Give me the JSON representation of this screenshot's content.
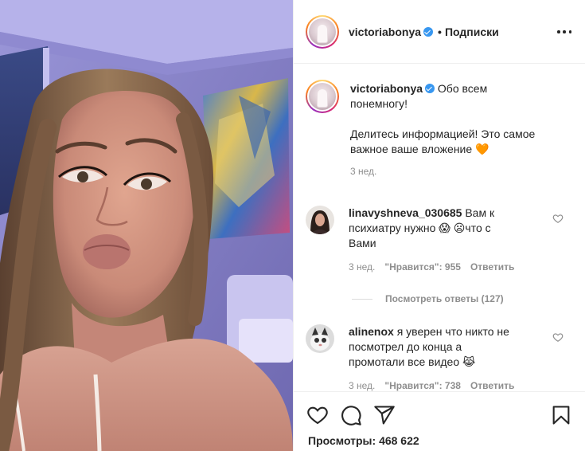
{
  "header": {
    "username": "victoriabonya",
    "separator": "•",
    "follow_label": "Подписки"
  },
  "caption": {
    "username": "victoriabonya",
    "line1": "Обо всем",
    "line2": "понемногу!",
    "line3": "Делитесь информацией! Это самое",
    "line4": "важное ваше вложение",
    "emoji": "🧡",
    "time": "3 нед."
  },
  "comments": [
    {
      "username": "linavyshneva_030685",
      "line1": "Вам к",
      "line2": "психиатру нужно",
      "emoji1": "😱",
      "emoji2": "😦",
      "line2b": "что с",
      "line3": "Вами",
      "time": "3 нед.",
      "likes_label": "\"Нравится\": 955",
      "reply_label": "Ответить",
      "view_replies": "Посмотреть ответы (127)"
    },
    {
      "username": "alinenox",
      "line1": "я уверен что никто не",
      "line2": "посмотрел до конца а",
      "line3": "промотали все видео",
      "emoji": "😹",
      "time": "3 нед.",
      "likes_label": "\"Нравится\": 738",
      "reply_label": "Ответить"
    }
  ],
  "footer": {
    "views_label": "Просмотры:",
    "views_count": "468 622"
  },
  "icons": {
    "like": "heart-icon",
    "comment": "comment-icon",
    "share": "share-icon",
    "save": "bookmark-icon",
    "more": "more-icon",
    "verified": "verified-badge-icon"
  },
  "colors": {
    "text": "#262626",
    "muted": "#8e8e8e",
    "verified": "#3897f0",
    "border": "#efefef"
  }
}
